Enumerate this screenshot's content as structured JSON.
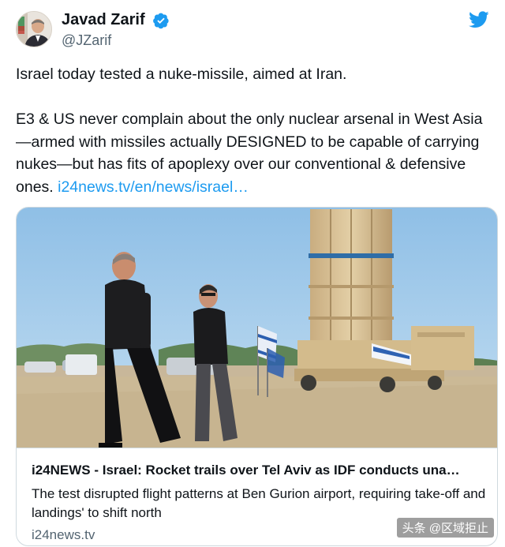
{
  "tweet": {
    "display_name": "Javad Zarif",
    "handle": "@JZarif",
    "verified_icon": "verified-badge-icon",
    "platform_icon": "twitter-bird-icon",
    "text_line1": "Israel today tested a nuke-missile, aimed at Iran.",
    "text_para2": "E3 & US never complain about the only nuclear arsenal in West Asia—armed with missiles actually DESIGNED to be capable of carrying nukes—but has fits of apoplexy over our conventional & defensive ones.",
    "link_text": "i24news.tv/en/news/israel…"
  },
  "card": {
    "title": "i24NEWS - Israel: Rocket trails over Tel Aviv as IDF conducts una…",
    "description": "The test disrupted flight patterns at Ben Gurion airport, requiring take-off and landings' to shift north",
    "domain": "i24news.tv"
  },
  "watermark": "头条 @区域拒止",
  "colors": {
    "link": "#1d9bf0",
    "twitter_blue": "#1d9bf0",
    "secondary_text": "#536471",
    "border": "#cfd9de"
  }
}
